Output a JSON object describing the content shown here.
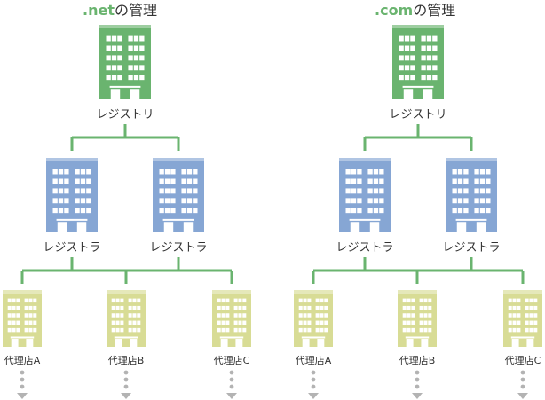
{
  "trees": [
    {
      "title_tld": ".net",
      "title_suffix": "の管理",
      "registry": {
        "label": "レジストリ"
      },
      "registrars": [
        {
          "label": "レジストラ"
        },
        {
          "label": "レジストラ"
        }
      ],
      "agents": [
        {
          "label": "代理店A"
        },
        {
          "label": "代理店B"
        },
        {
          "label": "代理店C"
        }
      ]
    },
    {
      "title_tld": ".com",
      "title_suffix": "の管理",
      "registry": {
        "label": "レジストリ"
      },
      "registrars": [
        {
          "label": "レジストラ"
        },
        {
          "label": "レジストラ"
        }
      ],
      "agents": [
        {
          "label": "代理店A"
        },
        {
          "label": "代理店B"
        },
        {
          "label": "代理店C"
        }
      ]
    }
  ],
  "colors": {
    "registry": "#6ab46f",
    "registrar": "#86a6d4",
    "agent": "#d8dc95",
    "connector": "#6ab46f",
    "arrow": "#b3b3b3"
  }
}
